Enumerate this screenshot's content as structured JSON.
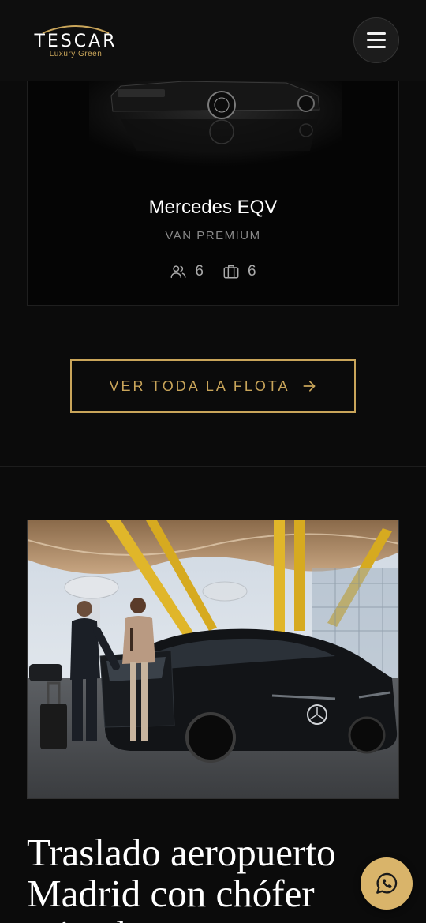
{
  "header": {
    "brand": "TESCAR",
    "tagline": "Luxury Green",
    "menu_label": "menu"
  },
  "vehicle": {
    "name": "Mercedes EQV",
    "category": "VAN PREMIUM",
    "passengers": "6",
    "luggage": "6"
  },
  "cta": {
    "label": "VER TODA LA FLOTA"
  },
  "article": {
    "title": "Traslado aeropuerto Madrid con chófer privado"
  },
  "colors": {
    "accent": "#c9a55a",
    "background": "#0b0b0b",
    "whatsapp_button": "#d9b46a"
  },
  "icons": [
    "menu-icon",
    "users-icon",
    "briefcase-icon",
    "arrow-right-icon",
    "whatsapp-icon"
  ]
}
